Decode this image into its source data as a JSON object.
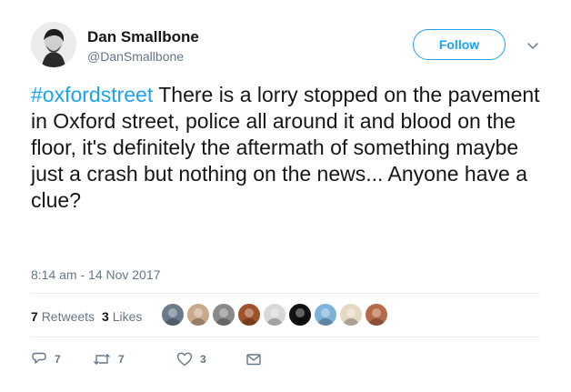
{
  "user": {
    "name": "Dan Smallbone",
    "handle": "@DanSmallbone"
  },
  "follow_label": "Follow",
  "tweet": {
    "hashtag": "#oxfordstreet",
    "text": " There is a lorry stopped on the pavement in Oxford street, police all around it and blood on the floor, it's definitely the aftermath of something maybe just a crash but nothing on the news... Anyone have a clue?"
  },
  "timestamp": "8:14 am - 14 Nov 2017",
  "stats": {
    "retweets_count": "7",
    "retweets_label": "Retweets",
    "likes_count": "3",
    "likes_label": "Likes"
  },
  "likers": [
    {
      "name": "liker-avatar",
      "color": "#6b7b8c"
    },
    {
      "name": "liker-avatar",
      "color": "#c9a98a"
    },
    {
      "name": "liker-avatar",
      "color": "#8a8a8a"
    },
    {
      "name": "liker-avatar",
      "color": "#a0522d"
    },
    {
      "name": "liker-avatar",
      "color": "#d8d8d8"
    },
    {
      "name": "liker-avatar",
      "color": "#111111"
    },
    {
      "name": "liker-avatar",
      "color": "#7fb2d9"
    },
    {
      "name": "liker-avatar",
      "color": "#e6d9c3"
    },
    {
      "name": "liker-avatar",
      "color": "#b56b4a"
    }
  ],
  "actions": {
    "reply_count": "7",
    "retweet_count": "7",
    "like_count": "3"
  },
  "colors": {
    "accent": "#1da1f2",
    "secondary_text": "#657786",
    "divider": "#e6ecf0"
  }
}
